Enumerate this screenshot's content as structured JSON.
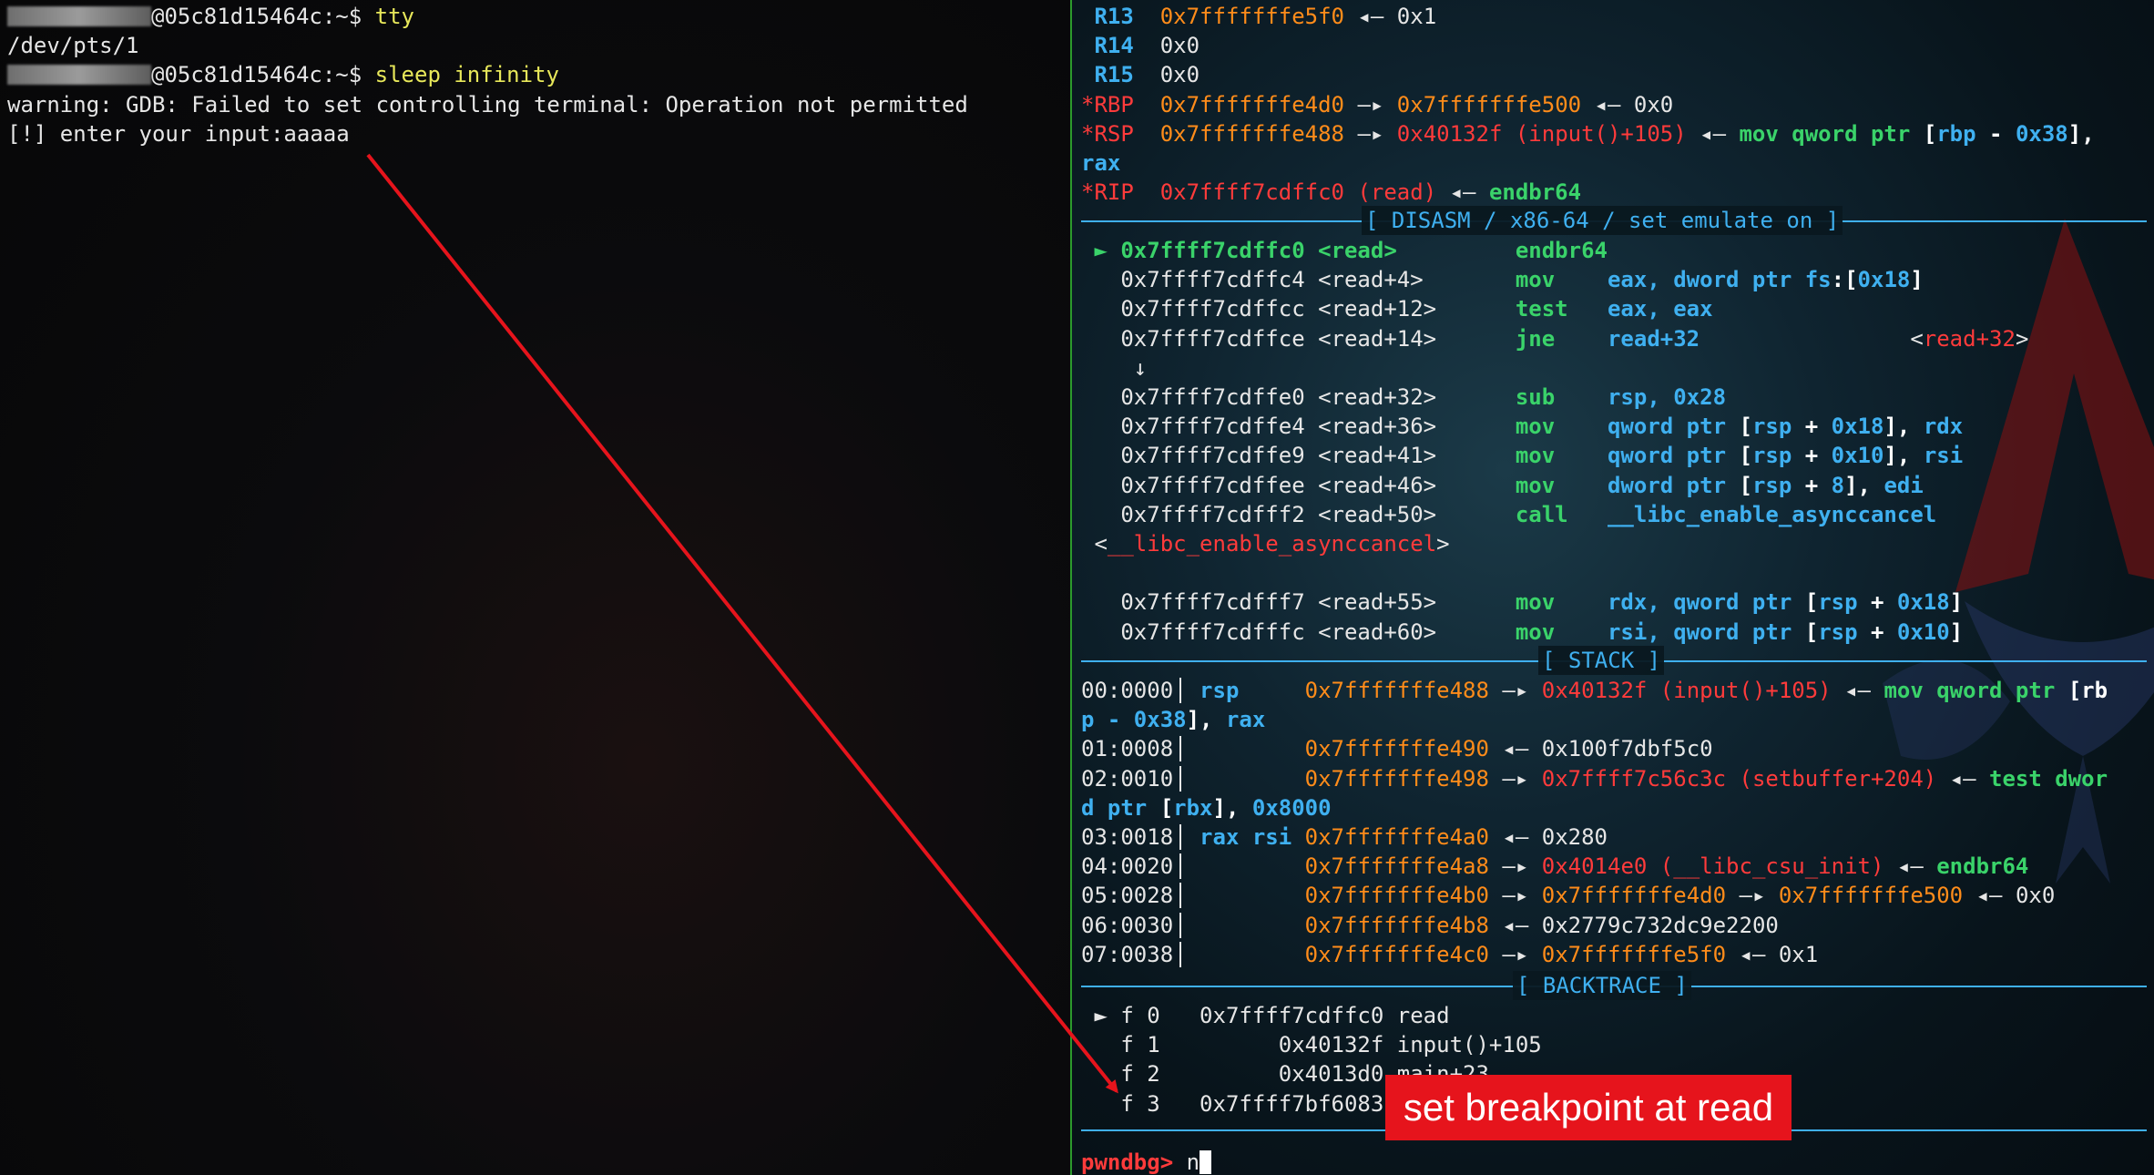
{
  "left": {
    "lines": [
      {
        "segments": [
          {
            "blur": true
          },
          {
            "t": "@05c81d15464c:~$ ",
            "c": "w"
          },
          {
            "t": "tty",
            "c": "y"
          }
        ]
      },
      {
        "segments": [
          {
            "t": "/dev/pts/1",
            "c": "w"
          }
        ]
      },
      {
        "segments": [
          {
            "blur": true
          },
          {
            "t": "@05c81d15464c:~$ ",
            "c": "w"
          },
          {
            "t": "sleep infinity",
            "c": "y"
          }
        ]
      },
      {
        "segments": [
          {
            "t": "warning: GDB: Failed to set controlling terminal: Operation not permitted",
            "c": "w"
          }
        ]
      },
      {
        "segments": [
          {
            "t": "[!] enter your input:aaaaa",
            "c": "w"
          }
        ]
      }
    ]
  },
  "right": {
    "registers": [
      {
        "segments": [
          {
            "t": " R13  ",
            "c": "rg"
          },
          {
            "t": "0x7fffffffe5f0",
            "c": "or"
          },
          {
            "t": " ◂— 0x1",
            "c": "w"
          }
        ]
      },
      {
        "segments": [
          {
            "t": " R14  ",
            "c": "rg"
          },
          {
            "t": "0x0",
            "c": "w"
          }
        ]
      },
      {
        "segments": [
          {
            "t": " R15  ",
            "c": "rg"
          },
          {
            "t": "0x0",
            "c": "w"
          }
        ]
      },
      {
        "segments": [
          {
            "t": "*RBP  ",
            "c": "rr"
          },
          {
            "t": "0x7fffffffe4d0",
            "c": "or"
          },
          {
            "t": " —▸ ",
            "c": "w"
          },
          {
            "t": "0x7fffffffe500",
            "c": "or"
          },
          {
            "t": " ◂— 0x0",
            "c": "w"
          }
        ]
      },
      {
        "segments": [
          {
            "t": "*RSP  ",
            "c": "rr"
          },
          {
            "t": "0x7fffffffe488",
            "c": "or"
          },
          {
            "t": " —▸ ",
            "c": "w"
          },
          {
            "t": "0x40132f (input()+105)",
            "c": "rd"
          },
          {
            "t": " ◂— ",
            "c": "w"
          },
          {
            "t": "mov qword ptr ",
            "c": "gn"
          },
          {
            "t": "[",
            "c": "bw"
          },
          {
            "t": "rbp",
            "c": "cyb"
          },
          {
            "t": " - ",
            "c": "bw"
          },
          {
            "t": "0x38",
            "c": "cyb"
          },
          {
            "t": "],",
            "c": "bw"
          }
        ]
      },
      {
        "segments": [
          {
            "t": "rax",
            "c": "cyb"
          }
        ]
      },
      {
        "segments": [
          {
            "t": "*RIP  ",
            "c": "rr"
          },
          {
            "t": "0x7ffff7cdffc0 (read)",
            "c": "rd"
          },
          {
            "t": " ◂— ",
            "c": "w"
          },
          {
            "t": "endbr64",
            "c": "gn"
          }
        ]
      }
    ],
    "disasm_title": "[ DISASM / x86-64 / set emulate on ]",
    "disasm": [
      {
        "segments": [
          {
            "t": " ► 0x7ffff7cdffc0 <read>         ",
            "c": "gn"
          },
          {
            "t": "endbr64",
            "c": "gn"
          }
        ]
      },
      {
        "segments": [
          {
            "t": "   0x7ffff7cdffc4 <read+4>       ",
            "c": "w"
          },
          {
            "t": "mov    ",
            "c": "gn"
          },
          {
            "t": "eax, ",
            "c": "cyb"
          },
          {
            "t": "dword ptr ",
            "c": "cyb"
          },
          {
            "t": "fs",
            "c": "cyb"
          },
          {
            "t": ":[",
            "c": "bw"
          },
          {
            "t": "0x18",
            "c": "cyb"
          },
          {
            "t": "]",
            "c": "bw"
          }
        ]
      },
      {
        "segments": [
          {
            "t": "   0x7ffff7cdffcc <read+12>      ",
            "c": "w"
          },
          {
            "t": "test   ",
            "c": "gn"
          },
          {
            "t": "eax, eax",
            "c": "cyb"
          }
        ]
      },
      {
        "segments": [
          {
            "t": "   0x7ffff7cdffce <read+14>      ",
            "c": "w"
          },
          {
            "t": "jne    ",
            "c": "gn"
          },
          {
            "t": "read+32",
            "c": "cyb"
          },
          {
            "t": "                <",
            "c": "w"
          },
          {
            "t": "read+32",
            "c": "rd"
          },
          {
            "t": ">",
            "c": "w"
          }
        ]
      },
      {
        "segments": [
          {
            "t": "    ↓",
            "c": "w"
          }
        ]
      },
      {
        "segments": [
          {
            "t": "   0x7ffff7cdffe0 <read+32>      ",
            "c": "w"
          },
          {
            "t": "sub    ",
            "c": "gn"
          },
          {
            "t": "rsp, 0x28",
            "c": "cyb"
          }
        ]
      },
      {
        "segments": [
          {
            "t": "   0x7ffff7cdffe4 <read+36>      ",
            "c": "w"
          },
          {
            "t": "mov    ",
            "c": "gn"
          },
          {
            "t": "qword ptr ",
            "c": "cyb"
          },
          {
            "t": "[",
            "c": "bw"
          },
          {
            "t": "rsp",
            "c": "cyb"
          },
          {
            "t": " + ",
            "c": "bw"
          },
          {
            "t": "0x18",
            "c": "cyb"
          },
          {
            "t": "], ",
            "c": "bw"
          },
          {
            "t": "rdx",
            "c": "cyb"
          }
        ]
      },
      {
        "segments": [
          {
            "t": "   0x7ffff7cdffe9 <read+41>      ",
            "c": "w"
          },
          {
            "t": "mov    ",
            "c": "gn"
          },
          {
            "t": "qword ptr ",
            "c": "cyb"
          },
          {
            "t": "[",
            "c": "bw"
          },
          {
            "t": "rsp",
            "c": "cyb"
          },
          {
            "t": " + ",
            "c": "bw"
          },
          {
            "t": "0x10",
            "c": "cyb"
          },
          {
            "t": "], ",
            "c": "bw"
          },
          {
            "t": "rsi",
            "c": "cyb"
          }
        ]
      },
      {
        "segments": [
          {
            "t": "   0x7ffff7cdffee <read+46>      ",
            "c": "w"
          },
          {
            "t": "mov    ",
            "c": "gn"
          },
          {
            "t": "dword ptr ",
            "c": "cyb"
          },
          {
            "t": "[",
            "c": "bw"
          },
          {
            "t": "rsp",
            "c": "cyb"
          },
          {
            "t": " + ",
            "c": "bw"
          },
          {
            "t": "8",
            "c": "cyb"
          },
          {
            "t": "], ",
            "c": "bw"
          },
          {
            "t": "edi",
            "c": "cyb"
          }
        ]
      },
      {
        "segments": [
          {
            "t": "   0x7ffff7cdfff2 <read+50>      ",
            "c": "w"
          },
          {
            "t": "call   ",
            "c": "gn"
          },
          {
            "t": "__libc_enable_asynccancel",
            "c": "cyb"
          }
        ]
      },
      {
        "segments": [
          {
            "t": " <",
            "c": "w"
          },
          {
            "t": "__libc_enable_asynccancel",
            "c": "rd"
          },
          {
            "t": ">",
            "c": "w"
          }
        ]
      },
      {
        "segments": [
          {
            "t": "",
            "c": "w"
          }
        ]
      },
      {
        "segments": [
          {
            "t": "   0x7ffff7cdfff7 <read+55>      ",
            "c": "w"
          },
          {
            "t": "mov    ",
            "c": "gn"
          },
          {
            "t": "rdx, ",
            "c": "cyb"
          },
          {
            "t": "qword ptr ",
            "c": "cyb"
          },
          {
            "t": "[",
            "c": "bw"
          },
          {
            "t": "rsp",
            "c": "cyb"
          },
          {
            "t": " + ",
            "c": "bw"
          },
          {
            "t": "0x18",
            "c": "cyb"
          },
          {
            "t": "]",
            "c": "bw"
          }
        ]
      },
      {
        "segments": [
          {
            "t": "   0x7ffff7cdfffc <read+60>      ",
            "c": "w"
          },
          {
            "t": "mov    ",
            "c": "gn"
          },
          {
            "t": "rsi, ",
            "c": "cyb"
          },
          {
            "t": "qword ptr ",
            "c": "cyb"
          },
          {
            "t": "[",
            "c": "bw"
          },
          {
            "t": "rsp",
            "c": "cyb"
          },
          {
            "t": " + ",
            "c": "bw"
          },
          {
            "t": "0x10",
            "c": "cyb"
          },
          {
            "t": "]",
            "c": "bw"
          }
        ]
      }
    ],
    "stack_title": "[ STACK ]",
    "stack": [
      {
        "segments": [
          {
            "t": "00:0000",
            "c": "w"
          },
          {
            "t": "  rsp     ",
            "c": "cyb"
          },
          {
            "t": "0x7fffffffe488",
            "c": "or"
          },
          {
            "t": " —▸ ",
            "c": "w"
          },
          {
            "t": "0x40132f (input()+105)",
            "c": "rd"
          },
          {
            "t": " ◂— ",
            "c": "w"
          },
          {
            "t": "mov qword ptr ",
            "c": "gn"
          },
          {
            "t": "[rb",
            "c": "bw"
          }
        ],
        "bar": true
      },
      {
        "segments": [
          {
            "t": "p - ",
            "c": "cyb"
          },
          {
            "t": "0x38",
            "c": "cyb"
          },
          {
            "t": "], ",
            "c": "bw"
          },
          {
            "t": "rax",
            "c": "cyb"
          }
        ]
      },
      {
        "segments": [
          {
            "t": "01:0008",
            "c": "w"
          },
          {
            "t": "          ",
            "c": "w"
          },
          {
            "t": "0x7fffffffe490",
            "c": "or"
          },
          {
            "t": " ◂— 0x100f7dbf5c0",
            "c": "w"
          }
        ],
        "bar": true
      },
      {
        "segments": [
          {
            "t": "02:0010",
            "c": "w"
          },
          {
            "t": "          ",
            "c": "w"
          },
          {
            "t": "0x7fffffffe498",
            "c": "or"
          },
          {
            "t": " —▸ ",
            "c": "w"
          },
          {
            "t": "0x7ffff7c56c3c (setbuffer+204)",
            "c": "rd"
          },
          {
            "t": " ◂— ",
            "c": "w"
          },
          {
            "t": "test dwor",
            "c": "gn"
          }
        ],
        "bar": true
      },
      {
        "segments": [
          {
            "t": "d ptr ",
            "c": "cyb"
          },
          {
            "t": "[",
            "c": "bw"
          },
          {
            "t": "rbx",
            "c": "cyb"
          },
          {
            "t": "], ",
            "c": "bw"
          },
          {
            "t": "0x8000",
            "c": "cyb"
          }
        ]
      },
      {
        "segments": [
          {
            "t": "03:0018",
            "c": "w"
          },
          {
            "t": "  rax rsi ",
            "c": "cyb"
          },
          {
            "t": "0x7fffffffe4a0",
            "c": "or"
          },
          {
            "t": " ◂— 0x280",
            "c": "w"
          }
        ],
        "bar": true
      },
      {
        "segments": [
          {
            "t": "04:0020",
            "c": "w"
          },
          {
            "t": "          ",
            "c": "w"
          },
          {
            "t": "0x7fffffffe4a8",
            "c": "or"
          },
          {
            "t": " —▸ ",
            "c": "w"
          },
          {
            "t": "0x4014e0 (__libc_csu_init)",
            "c": "rd"
          },
          {
            "t": " ◂— ",
            "c": "w"
          },
          {
            "t": "endbr64",
            "c": "gn"
          }
        ],
        "bar": true
      },
      {
        "segments": [
          {
            "t": "05:0028",
            "c": "w"
          },
          {
            "t": "          ",
            "c": "w"
          },
          {
            "t": "0x7fffffffe4b0",
            "c": "or"
          },
          {
            "t": " —▸ ",
            "c": "w"
          },
          {
            "t": "0x7fffffffe4d0",
            "c": "or"
          },
          {
            "t": " —▸ ",
            "c": "w"
          },
          {
            "t": "0x7fffffffe500",
            "c": "or"
          },
          {
            "t": " ◂— 0x0",
            "c": "w"
          }
        ],
        "bar": true
      },
      {
        "segments": [
          {
            "t": "06:0030",
            "c": "w"
          },
          {
            "t": "          ",
            "c": "w"
          },
          {
            "t": "0x7fffffffe4b8",
            "c": "or"
          },
          {
            "t": " ◂— 0x2779c732dc9e2200",
            "c": "w"
          }
        ],
        "bar": true
      },
      {
        "segments": [
          {
            "t": "07:0038",
            "c": "w"
          },
          {
            "t": "          ",
            "c": "w"
          },
          {
            "t": "0x7fffffffe4c0",
            "c": "or"
          },
          {
            "t": " —▸ ",
            "c": "w"
          },
          {
            "t": "0x7fffffffe5f0",
            "c": "or"
          },
          {
            "t": " ◂— 0x1",
            "c": "w"
          }
        ],
        "bar": true
      }
    ],
    "backtrace_title": "[ BACKTRACE ]",
    "backtrace": [
      {
        "segments": [
          {
            "t": " ► f 0   0x7ffff7cdffc0 read",
            "c": "w"
          }
        ]
      },
      {
        "segments": [
          {
            "t": "   f 1         0x40132f input()+105",
            "c": "w"
          }
        ]
      },
      {
        "segments": [
          {
            "t": "   f 2         0x4013d0 main+23",
            "c": "w"
          }
        ]
      },
      {
        "segments": [
          {
            "t": "   f 3   0x7ffff7bf6083",
            "c": "w"
          }
        ]
      }
    ],
    "prompt": "pwndbg> ",
    "command": "n"
  },
  "annotation": {
    "label": "set breakpoint at read",
    "color": "#e6141c"
  },
  "colors": {
    "divider": "#2c9a2c",
    "accent_blue": "#3fb0f0",
    "address_orange": "#ff8c1a",
    "symbol_red": "#ff3b3b",
    "mnemonic_green": "#3ad36a",
    "prompt_red": "#ff3b3b"
  }
}
